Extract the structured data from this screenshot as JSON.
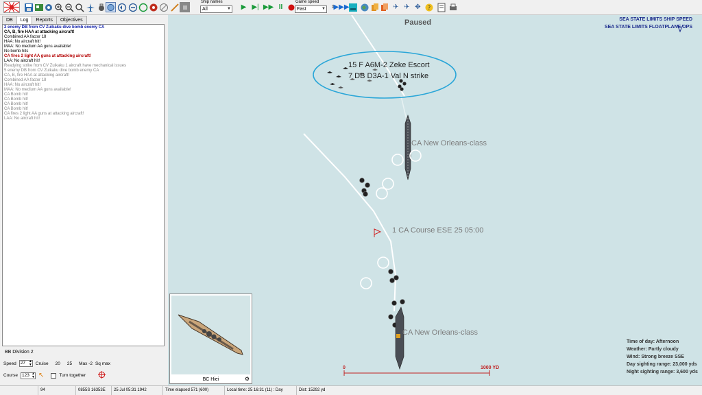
{
  "toolbar": {
    "ship_names_label": "Ship names",
    "ship_names_value": "All",
    "game_speed_label": "Game speed",
    "game_speed_value": "Fast"
  },
  "left_panel": {
    "tabs": [
      "DB",
      "Log",
      "Reports",
      "Objectives"
    ],
    "active_tab": "Log",
    "log": [
      {
        "text": "2 enemy DB from CV Zuikaku dive bomb enemy CA",
        "style": "blue"
      },
      {
        "text": "CA, B,  fire HAA at attacking aircraft!",
        "style": "blackb"
      },
      {
        "text": "Combined AA factor 18",
        "style": "black"
      },
      {
        "text": "HAA: No aircraft hit!",
        "style": "black"
      },
      {
        "text": "MAA: No medium AA guns available!",
        "style": "black"
      },
      {
        "text": "No bomb hits",
        "style": "black"
      },
      {
        "text": "CA fires 2 light AA guns at attacking aircraft!",
        "style": "red"
      },
      {
        "text": "LAA: No aircraft hit!",
        "style": "black"
      },
      {
        "text": "Readying strike from CV Zuikaku 1 aircraft have mechanical issues",
        "style": "gray"
      },
      {
        "text": "5 enemy DB from CV Zuikaku dive bomb enemy CA",
        "style": "gray"
      },
      {
        "text": "CA, B,  fire HAA at attacking aircraft!",
        "style": "gray"
      },
      {
        "text": "Combined AA factor 18",
        "style": "gray"
      },
      {
        "text": "HAA: No aircraft hit!",
        "style": "gray"
      },
      {
        "text": "MAA: No medium AA guns available!",
        "style": "gray"
      },
      {
        "text": "CA Bomb hit!",
        "style": "gray"
      },
      {
        "text": "CA Bomb hit!",
        "style": "gray"
      },
      {
        "text": "CA Bomb hit!",
        "style": "gray"
      },
      {
        "text": "CA Bomb hit!",
        "style": "gray"
      },
      {
        "text": "CA fires 2 light AA guns at attacking aircraft!",
        "style": "gray"
      },
      {
        "text": "LAA: No aircraft hit!",
        "style": "gray"
      }
    ],
    "unit": {
      "name": "BB Division 2",
      "speed_label": "Speed",
      "speed_value": "27",
      "cruise_label": "Cruise",
      "cruise_value": "20",
      "v25": "25",
      "max_label": "Max -2",
      "sq_max_label": "Sq max",
      "course_label": "Course",
      "course_value": "123",
      "turn_together_label": "Turn together"
    },
    "inset_label": "BC Hiei"
  },
  "map": {
    "paused": "Paused",
    "sea_state_1": "SEA STATE LIMITS SHIP SPEED",
    "sea_state_2": "SEA STATE LIMITS FLOATPLANE OPS",
    "air_group_1": "15 F A6M-2 Zeke Escort",
    "air_group_2": "7 DB D3A-1 Val N strike",
    "ship_label_1": "CA New Orleans-class",
    "ship_label_2": "CA New Orleans-class",
    "course_label": "1 CA Course ESE 25 05:00",
    "scale_zero": "0",
    "scale_label": "1000 YD",
    "time_of_day": "Time of day: Afternoon",
    "weather": "Weather: Partly cloudy",
    "wind": "Wind: Strong breeze  SSE",
    "day_sighting": "Day sighting range: 23,000 yds",
    "night_sighting": "Night sighting range: 3,600 yds"
  },
  "status": {
    "s1": "94",
    "s2": "0855S 16353E",
    "s3": "25 Jul 05:31 1942",
    "s4": "Time elapsed 571 (600)",
    "s5": "Local time: 25 16:31 (11) : Day",
    "s6": "Dist: 15292 yd"
  },
  "colors": {
    "sea": "#cfe3e6",
    "ellipse": "#2aa6d8",
    "scale": "#c02020",
    "sea_state_text": "#1a2a8c"
  }
}
